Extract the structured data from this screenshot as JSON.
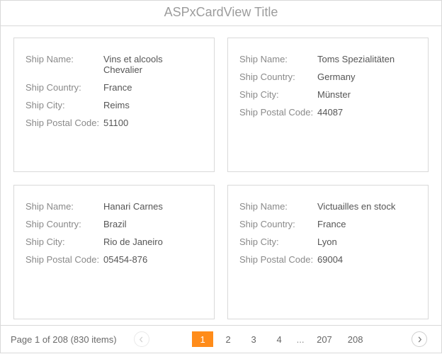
{
  "title": "ASPxCardView Title",
  "field_labels": {
    "ship_name": "Ship Name:",
    "ship_country": "Ship Country:",
    "ship_city": "Ship City:",
    "ship_postal": "Ship Postal Code:"
  },
  "cards": [
    {
      "ship_name": "Vins et alcools Chevalier",
      "ship_country": "France",
      "ship_city": "Reims",
      "ship_postal": "51100"
    },
    {
      "ship_name": "Toms Spezialitäten",
      "ship_country": "Germany",
      "ship_city": "Münster",
      "ship_postal": "44087"
    },
    {
      "ship_name": "Hanari Carnes",
      "ship_country": "Brazil",
      "ship_city": "Rio de Janeiro",
      "ship_postal": "05454-876"
    },
    {
      "ship_name": "Victuailles en stock",
      "ship_country": "France",
      "ship_city": "Lyon",
      "ship_postal": "69004"
    }
  ],
  "pager": {
    "summary": "Page 1 of 208 (830 items)",
    "pages": [
      "1",
      "2",
      "3",
      "4",
      "...",
      "207",
      "208"
    ],
    "current": "1",
    "prev_disabled": true,
    "next_disabled": false
  }
}
